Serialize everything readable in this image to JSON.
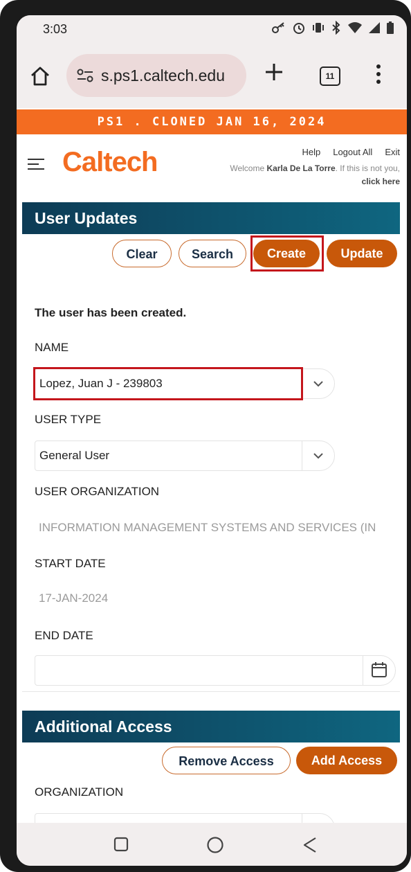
{
  "status_bar": {
    "time": "3:03"
  },
  "browser": {
    "url": "s.ps1.caltech.edu",
    "tab_count": "11"
  },
  "banner": {
    "text": "PS1 . CLONED JAN 16, 2024"
  },
  "header": {
    "logo": "Caltech",
    "links": {
      "help": "Help",
      "logout": "Logout All",
      "exit": "Exit"
    },
    "welcome_prefix": "Welcome",
    "welcome_user": "Karla De La Torre",
    "welcome_mid": ". If this is not you,",
    "welcome_link": "click here"
  },
  "user_updates": {
    "title": "User Updates",
    "buttons": {
      "clear": "Clear",
      "search": "Search",
      "create": "Create",
      "update": "Update"
    },
    "message": "The user has been created.",
    "name_label": "NAME",
    "name_value": "Lopez, Juan J - 239803",
    "user_type_label": "USER TYPE",
    "user_type_value": "General User",
    "user_org_label": "USER ORGANIZATION",
    "user_org_value": "INFORMATION MANAGEMENT SYSTEMS AND SERVICES (IN",
    "start_date_label": "START DATE",
    "start_date_value": "17-JAN-2024",
    "end_date_label": "END DATE",
    "end_date_value": ""
  },
  "additional_access": {
    "title": "Additional Access",
    "buttons": {
      "remove": "Remove Access",
      "add": "Add Access"
    },
    "org_label": "ORGANIZATION"
  },
  "colors": {
    "caltech_orange": "#f36c21",
    "button_orange": "#c8580a",
    "header_teal": "#0f6680",
    "highlight_red": "#c4161c"
  }
}
